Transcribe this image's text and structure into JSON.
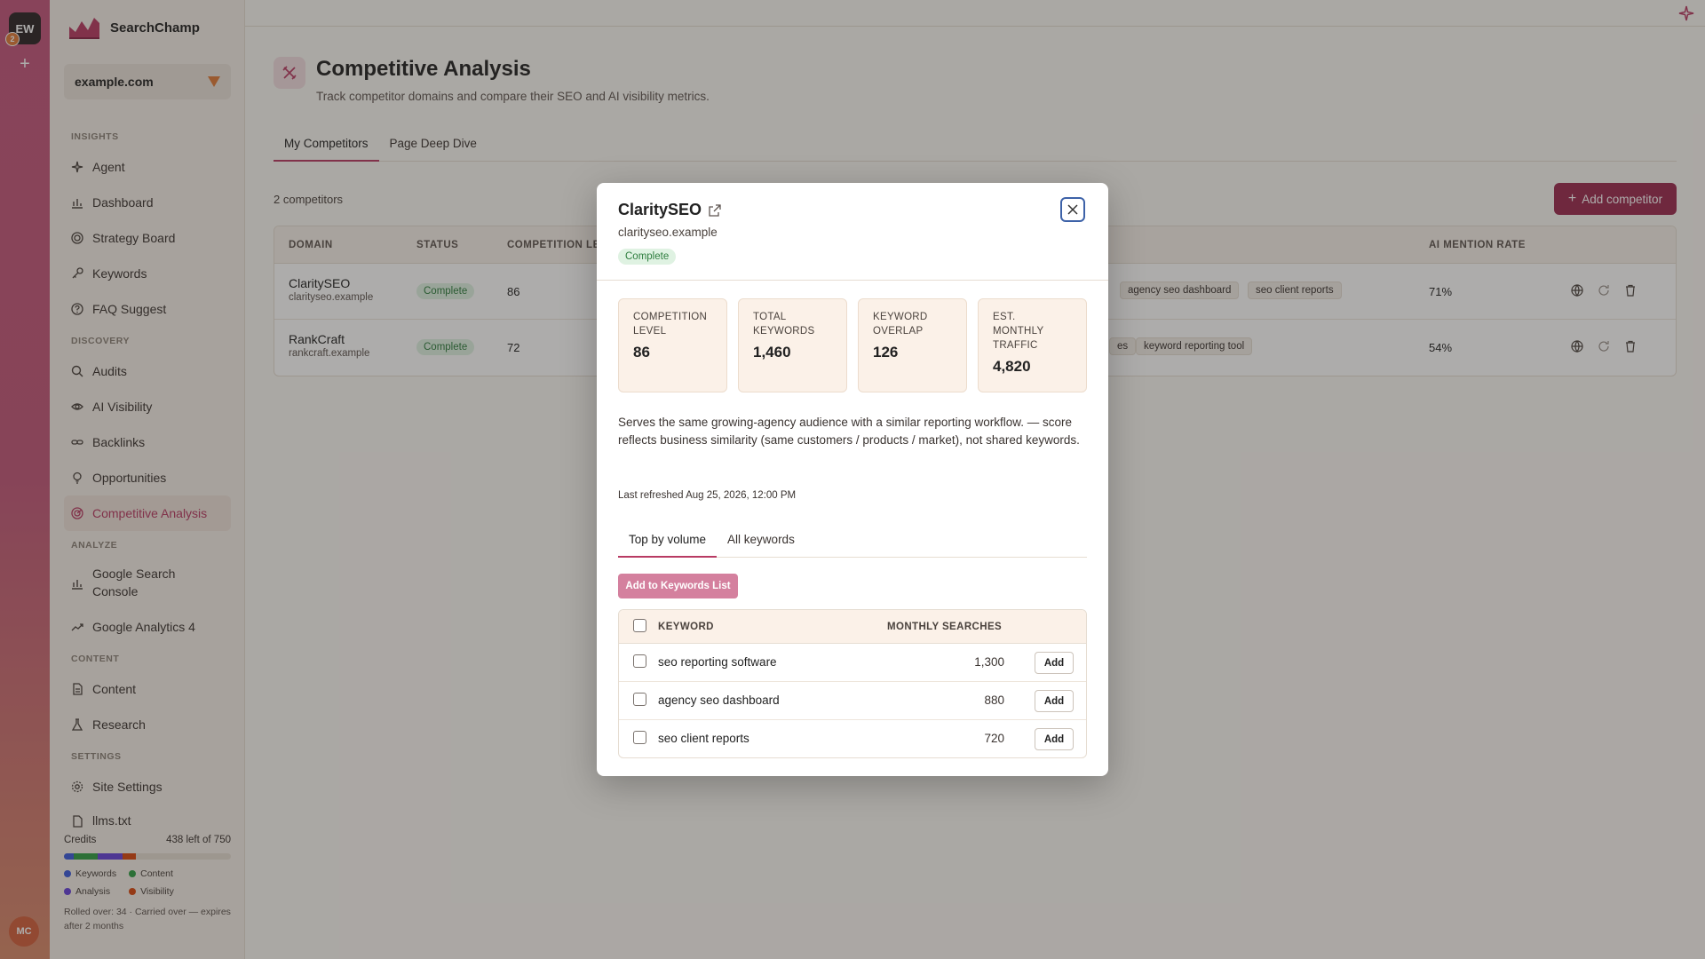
{
  "rail": {
    "workspace_initials": "EW",
    "badge_count": "2",
    "add_symbol": "+",
    "user_initials": "MC"
  },
  "brand": {
    "name": "SearchChamp"
  },
  "site_select": {
    "value": "example.com"
  },
  "nav": {
    "insights_label": "INSIGHTS",
    "insights": [
      "Agent",
      "Dashboard",
      "Strategy Board",
      "Keywords",
      "FAQ Suggest"
    ],
    "discovery_label": "DISCOVERY",
    "discovery": [
      "Audits",
      "AI Visibility",
      "Backlinks",
      "Opportunities",
      "Competitive Analysis"
    ],
    "analyze_label": "ANALYZE",
    "analyze": [
      "Google Search Console",
      "Google Analytics 4"
    ],
    "content_label": "CONTENT",
    "content": [
      "Content",
      "Research"
    ],
    "settings_label": "SETTINGS",
    "settings": [
      "Site Settings",
      "llms.txt"
    ]
  },
  "credits": {
    "label": "Credits",
    "remaining": "438 left of 750",
    "legend": [
      "Keywords",
      "Content",
      "Analysis",
      "Visibility"
    ],
    "colors": [
      "#3b5bdb",
      "#2f9e44",
      "#6741d9",
      "#d9480f"
    ],
    "usage": [
      0.06,
      0.14,
      0.15,
      0.08
    ],
    "note": "Rolled over: 34 · Carried over — expires after 2 months"
  },
  "page": {
    "title": "Competitive Analysis",
    "subtitle": "Track competitor domains and compare their SEO and AI visibility metrics.",
    "tabs": [
      "My Competitors",
      "Page Deep Dive"
    ],
    "count": "2 competitors",
    "add_button": "Add competitor"
  },
  "table": {
    "headers": {
      "domain": "DOMAIN",
      "status": "STATUS",
      "competition": "COMPETITION LE",
      "ai_rate": "AI MENTION RATE"
    },
    "rows": [
      {
        "name": "ClaritySEO",
        "domain": "clarityseo.example",
        "status": "Complete",
        "level": "86",
        "chips": [
          "agency seo dashboard",
          "seo client reports"
        ],
        "rate": "71%"
      },
      {
        "name": "RankCraft",
        "domain": "rankcraft.example",
        "status": "Complete",
        "level": "72",
        "chips": [
          "es",
          "keyword reporting tool"
        ],
        "rate": "54%"
      }
    ]
  },
  "modal": {
    "title": "ClaritySEO",
    "domain": "clarityseo.example",
    "status": "Complete",
    "stats": [
      {
        "label": "COMPETITION LEVEL",
        "value": "86"
      },
      {
        "label": "TOTAL KEYWORDS",
        "value": "1,460"
      },
      {
        "label": "KEYWORD OVERLAP",
        "value": "126"
      },
      {
        "label": "EST. MONTHLY TRAFFIC",
        "value": "4,820"
      }
    ],
    "description": "Serves the same growing-agency audience with a similar reporting workflow. — score reflects business similarity (same customers / products / market), not shared keywords.",
    "refreshed": "Last refreshed Aug 25, 2026, 12:00 PM",
    "tabs": [
      "Top by volume",
      "All keywords"
    ],
    "add_list": "Add to Keywords List",
    "kw_headers": {
      "keyword": "KEYWORD",
      "monthly": "MONTHLY SEARCHES"
    },
    "keywords": [
      {
        "keyword": "seo reporting software",
        "volume": "1,300",
        "action": "Add"
      },
      {
        "keyword": "agency seo dashboard",
        "volume": "880",
        "action": "Add"
      },
      {
        "keyword": "seo client reports",
        "volume": "720",
        "action": "Add"
      }
    ]
  }
}
